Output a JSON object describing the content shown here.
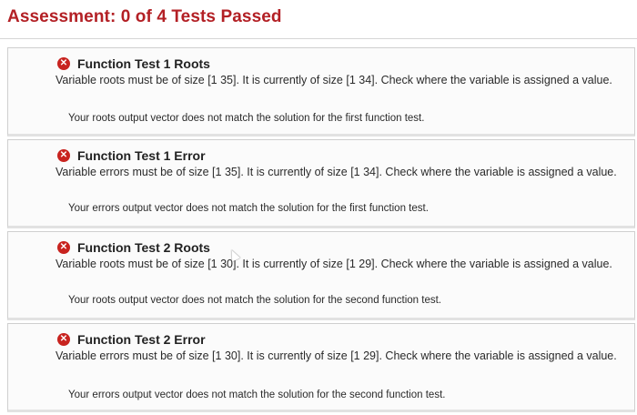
{
  "header": {
    "title": "Assessment: 0 of 4 Tests Passed"
  },
  "colors": {
    "title_red": "#b32025",
    "fail_icon": "#c8231f"
  },
  "tests": [
    {
      "icon": "fail-x-icon",
      "name": "Function Test 1 Roots",
      "message": "Variable roots must be of size [1 35]. It is currently of size [1 34]. Check where the variable is assigned a value.",
      "detail": "Your roots output vector does not match the solution for the first function test."
    },
    {
      "icon": "fail-x-icon",
      "name": "Function Test 1 Error",
      "message": "Variable errors must be of size [1 35]. It is currently of size [1 34]. Check where the variable is assigned a value.",
      "detail": "Your errors output vector does not match the solution for the first function test."
    },
    {
      "icon": "fail-x-icon",
      "name": "Function Test 2 Roots",
      "message": "Variable roots must be of size [1 30]. It is currently of size [1 29]. Check where the variable is assigned a value.",
      "detail": "Your roots output vector does not match the solution for the second function test."
    },
    {
      "icon": "fail-x-icon",
      "name": "Function Test 2 Error",
      "message": "Variable errors must be of size [1 30]. It is currently of size [1 29]. Check where the variable is assigned a value.",
      "detail": "Your errors output vector does not match the solution for the second function test."
    }
  ]
}
